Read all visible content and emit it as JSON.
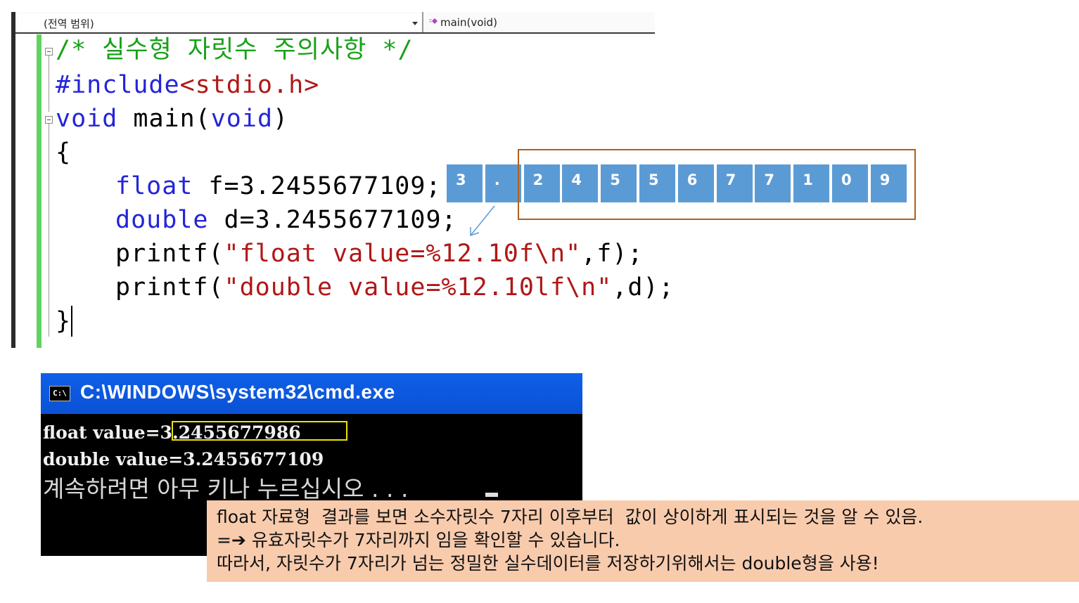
{
  "toolbar": {
    "scope_label": "(전역 범위)",
    "member_label": "main(void)"
  },
  "code": {
    "line1": "/* 실수형 자릿수 주의사항 */",
    "line2_directive": "#include",
    "line2_header": "<stdio.h>",
    "line3_type": "void",
    "line3_name": " main(",
    "line3_param": "void",
    "line3_close": ")",
    "line4": "{",
    "line5_type": "float",
    "line5_rest": " f=3.2455677109;",
    "line6_type": "double",
    "line6_rest": " d=3.2455677109;",
    "line7_fn": "printf(",
    "line7_str": "\"float value=%12.10f\\n\"",
    "line7_rest": ",f);",
    "line8_fn": "printf(",
    "line8_str": "\"double value=%12.10lf\\n\"",
    "line8_rest": ",d);",
    "line9": "}"
  },
  "digits": [
    "3",
    ".",
    "2",
    "4",
    "5",
    "5",
    "6",
    "7",
    "7",
    "1",
    "0",
    "9"
  ],
  "console": {
    "title": "C:\\WINDOWS\\system32\\cmd.exe",
    "icon_text": "C:\\",
    "line1_label": "float value",
    "line1_value": "=3.2455677986",
    "line2": "double value=3.2455677109",
    "line3": "계속하려면 아무 키나 누르십시오 . . ."
  },
  "note": {
    "line1": "float 자료형  결과를 보면 소수자릿수 7자리 이후부터  값이 상이하게 표시되는 것을 알 수 있음.",
    "line2": "=➔ 유효자릿수가 7자리까지 임을 확인할 수 있습니다.",
    "line3": "따라서, 자릿수가 7자리가 넘는 정밀한 실수데이터를 저장하기위해서는 double형을 사용!"
  },
  "colors": {
    "keyword": "#2424d8",
    "comment": "#19a019",
    "string": "#b01717",
    "digit_box": "#5b9bd5",
    "highlight_border": "#b25f1c",
    "console_title": "#0a52d6",
    "note_bg": "#f8cbad"
  }
}
